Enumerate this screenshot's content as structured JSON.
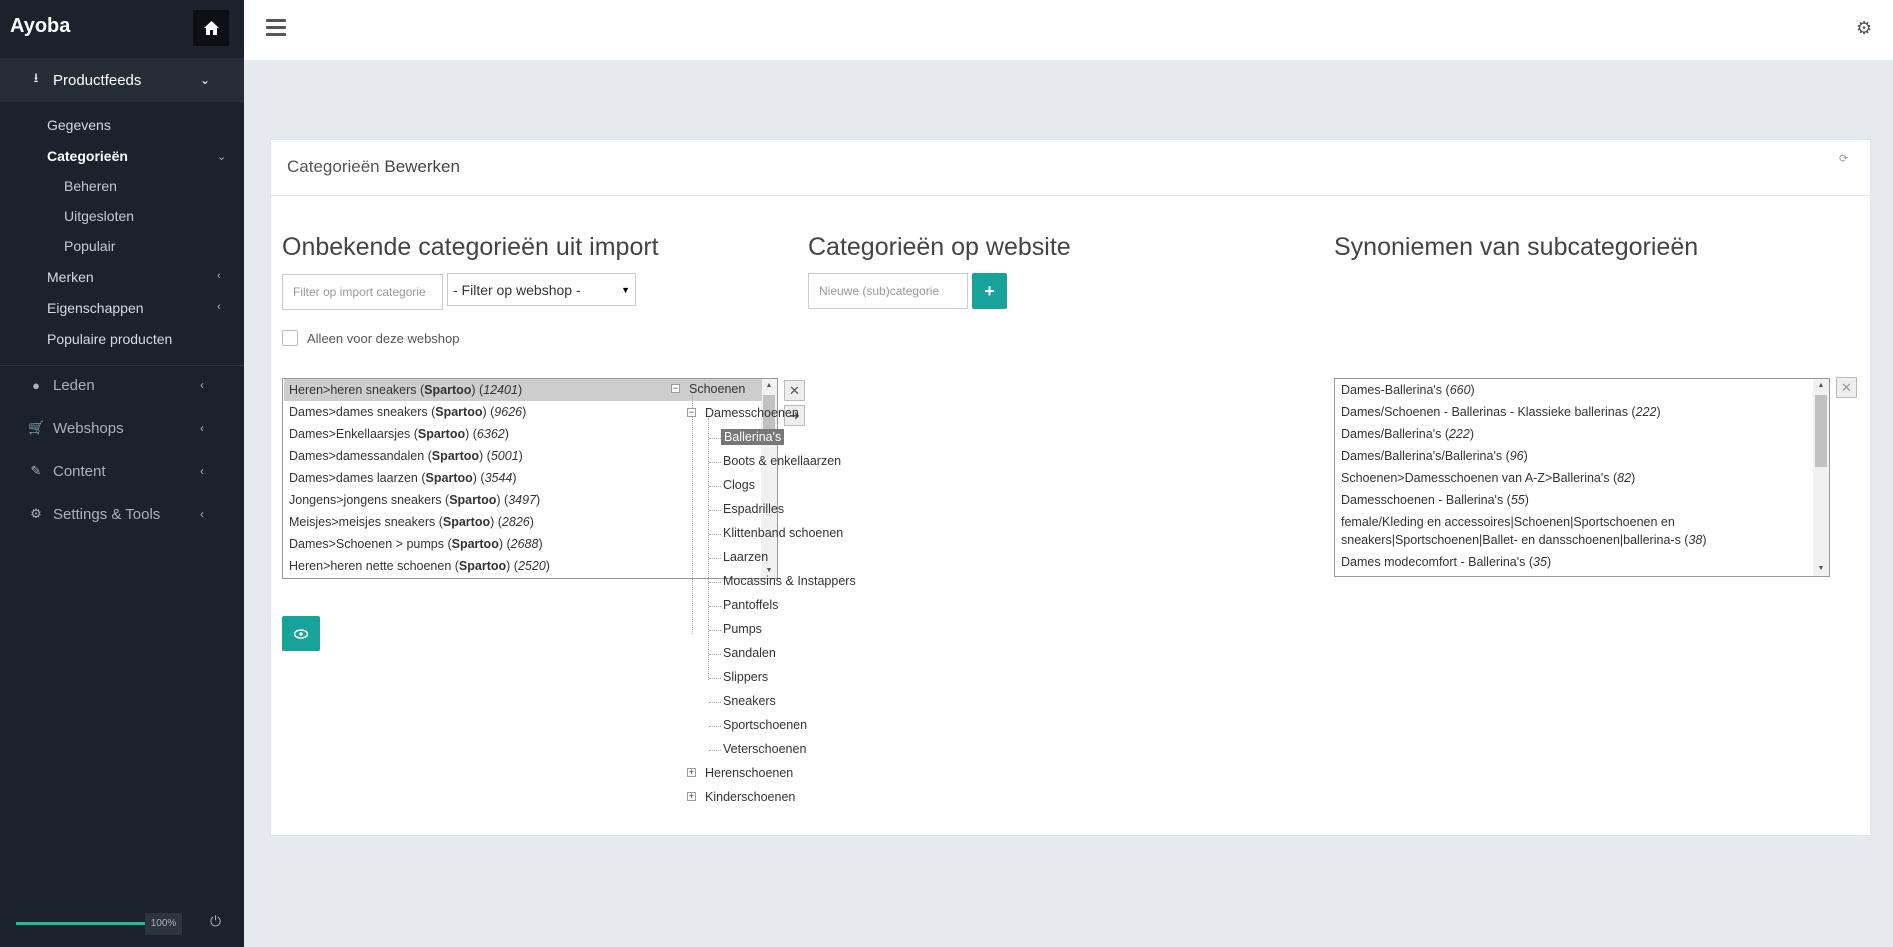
{
  "brand": "Ayoba",
  "sidebar": {
    "productfeeds": "Productfeeds",
    "gegevens": "Gegevens",
    "categorieen": "Categorieën",
    "beheren": "Beheren",
    "uitgesloten": "Uitgesloten",
    "populair": "Populair",
    "merken": "Merken",
    "eigenschappen": "Eigenschappen",
    "populaire_producten": "Populaire producten",
    "leden": "Leden",
    "webshops": "Webshops",
    "content": "Content",
    "settings": "Settings & Tools",
    "progress_label": "100%",
    "progress_value": 100
  },
  "panel": {
    "title_part1": "Categorieën",
    "title_part2": "Bewerken"
  },
  "import_col": {
    "title": "Onbekende categorieën uit import",
    "filter_placeholder": "Filter op import categorie",
    "webshop_select": "- Filter op webshop -",
    "checkbox_label": "Alleen voor deze webshop",
    "items": [
      {
        "path": "Heren>heren sneakers",
        "shop": "Spartoo",
        "count": "12401"
      },
      {
        "path": "Dames>dames sneakers",
        "shop": "Spartoo",
        "count": "9626"
      },
      {
        "path": "Dames>Enkellaarsjes",
        "shop": "Spartoo",
        "count": "6362"
      },
      {
        "path": "Dames>damessandalen",
        "shop": "Spartoo",
        "count": "5001"
      },
      {
        "path": "Dames>dames laarzen",
        "shop": "Spartoo",
        "count": "3544"
      },
      {
        "path": "Jongens>jongens sneakers",
        "shop": "Spartoo",
        "count": "3497"
      },
      {
        "path": "Meisjes>meisjes sneakers",
        "shop": "Spartoo",
        "count": "2826"
      },
      {
        "path": "Dames>Schoenen > pumps",
        "shop": "Spartoo",
        "count": "2688"
      },
      {
        "path": "Heren>heren nette schoenen",
        "shop": "Spartoo",
        "count": "2520"
      }
    ]
  },
  "website_col": {
    "title": "Categorieën op website",
    "new_placeholder": "Nieuwe (sub)categorie",
    "tree": {
      "root": "Schoenen",
      "dames": "Damesschoenen",
      "dames_children": [
        "Ballerina's",
        "Boots & enkellaarzen",
        "Clogs",
        "Espadrilles",
        "Klittenband schoenen",
        "Laarzen",
        "Mocassins & Instappers",
        "Pantoffels",
        "Pumps",
        "Sandalen",
        "Slippers",
        "Sneakers",
        "Sportschoenen",
        "Veterschoenen"
      ],
      "heren": "Herenschoenen",
      "kinder": "Kinderschoenen"
    }
  },
  "synonym_col": {
    "title": "Synoniemen van subcategorieën",
    "items": [
      {
        "text": "Dames-Ballerina's",
        "count": "660"
      },
      {
        "text": "Dames/Schoenen - Ballerinas - Klassieke ballerinas",
        "count": "222"
      },
      {
        "text": "Dames/Ballerina's",
        "count": "222"
      },
      {
        "text": "Dames/Ballerina's/Ballerina's",
        "count": "96"
      },
      {
        "text": "Schoenen>Damesschoenen van A-Z>Ballerina's",
        "count": "82"
      },
      {
        "text": "Damesschoenen - Ballerina's",
        "count": "55"
      },
      {
        "text": "female/Kleding en accessoires|Schoenen|Sportschoenen en",
        "count": ""
      },
      {
        "text": "sneakers|Sportschoenen|Ballet- en dansschoenen|ballerina-s",
        "count": "38"
      },
      {
        "text": "Dames modecomfort - Ballerina's",
        "count": "35"
      }
    ]
  }
}
